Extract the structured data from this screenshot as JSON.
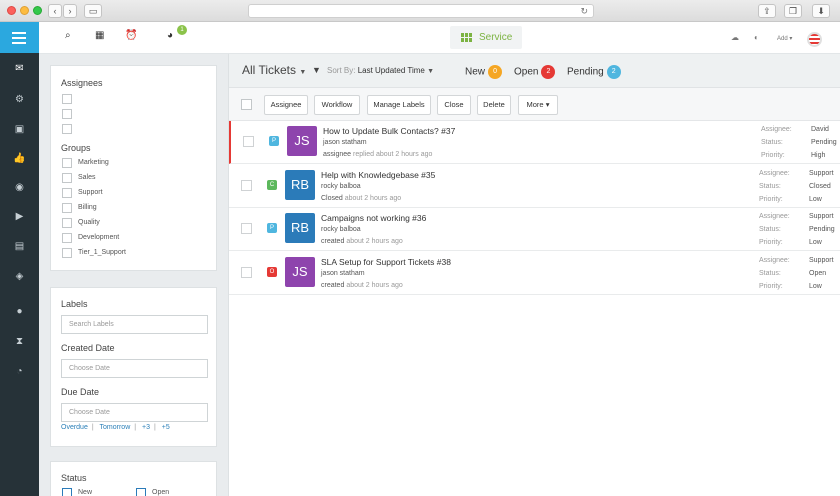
{
  "app": {
    "service_label": "Service",
    "notification_count": "1",
    "add_label": "Add"
  },
  "rail_icons": [
    "menu-icon",
    "mail-icon",
    "network-icon",
    "box-icon",
    "thumbs-up-icon",
    "palette-icon",
    "tag-icon",
    "comment-icon",
    "layers-icon",
    "chat-icon",
    "hourglass-icon",
    "pie-chart-icon"
  ],
  "filters": {
    "assignees_title": "Assignees",
    "groups_title": "Groups",
    "groups": [
      "Marketing",
      "Sales",
      "Support",
      "Billing",
      "Quality",
      "Development",
      "Tier_1_Support"
    ],
    "labels_title": "Labels",
    "labels_placeholder": "Search Labels",
    "created_title": "Created Date",
    "created_placeholder": "Choose Date",
    "due_title": "Due Date",
    "due_placeholder": "Choose Date",
    "quick": [
      "Overdue",
      "Tomorrow",
      "+3",
      "+5"
    ],
    "status_title": "Status",
    "status_options": [
      "New",
      "Open"
    ]
  },
  "list": {
    "title": "All Tickets",
    "sort_prefix": "Sort By:",
    "sort_value": "Last Updated Time",
    "counters": [
      {
        "label": "New",
        "count": "0",
        "color": "#f5a623"
      },
      {
        "label": "Open",
        "count": "2",
        "color": "#e53935"
      },
      {
        "label": "Pending",
        "count": "2",
        "color": "#4fb6df"
      }
    ],
    "actions": [
      "Assignee",
      "Workflow",
      "Manage Labels",
      "Close",
      "Delete",
      "More"
    ]
  },
  "meta_labels": {
    "assignee": "Assignee:",
    "status": "Status:",
    "priority": "Priority:"
  },
  "tickets": [
    {
      "prio": "P",
      "prio_color": "#4fb6df",
      "initials": "JS",
      "avatar_color": "#8e44ad",
      "subject": "How to Update Bulk Contacts? #37",
      "requester": "jason statham",
      "activity_who": "assignee",
      "activity": "replied about 2 hours ago",
      "assignee": "David",
      "status": "Pending",
      "priority": "High"
    },
    {
      "prio": "C",
      "prio_color": "#5cb85c",
      "initials": "RB",
      "avatar_color": "#2b7bb9",
      "subject": "Help with Knowledgebase #35",
      "requester": "rocky balboa",
      "activity_who": "Closed",
      "activity": "about 2 hours ago",
      "assignee": "Support",
      "status": "Closed",
      "priority": "Low"
    },
    {
      "prio": "P",
      "prio_color": "#4fb6df",
      "initials": "RB",
      "avatar_color": "#2b7bb9",
      "subject": "Campaigns not working #36",
      "requester": "rocky balboa",
      "activity_who": "created",
      "activity": "about 2 hours ago",
      "assignee": "Support",
      "status": "Pending",
      "priority": "Low"
    },
    {
      "prio": "O",
      "prio_color": "#e53935",
      "initials": "JS",
      "avatar_color": "#8e44ad",
      "subject": "SLA Setup for Support Tickets #38",
      "requester": "jason statham",
      "activity_who": "created",
      "activity": "about 2 hours ago",
      "assignee": "Support",
      "status": "Open",
      "priority": "Low"
    }
  ]
}
